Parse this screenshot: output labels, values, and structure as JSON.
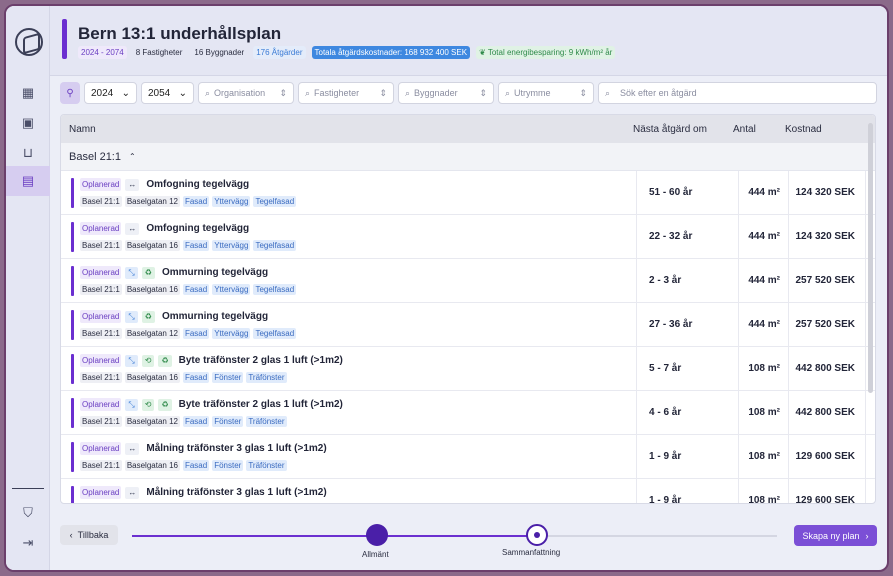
{
  "header": {
    "title": "Bern 13:1 underhållsplan",
    "badges": {
      "period": "2024 - 2074",
      "properties": "8 Fastigheter",
      "buildings": "16 Byggnader",
      "actions": "176 Åtgärder",
      "total_cost": "Totala åtgärdskostnader: 168 932 400 SEK",
      "energy": "Total energibesparing: 9 kWh/m² år"
    }
  },
  "filters": {
    "year_from": "2024",
    "year_to": "2054",
    "organisation": "Organisation",
    "properties": "Fastigheter",
    "buildings": "Byggnader",
    "spaces": "Utrymme",
    "search_placeholder": "Sök efter en åtgärd"
  },
  "table": {
    "headers": {
      "name": "Namn",
      "next": "Nästa åtgärd om",
      "count": "Antal",
      "cost": "Kostnad"
    },
    "group": "Basel 21:1",
    "rows": [
      {
        "status": "Oplanerad",
        "title": "Omfogning tegelvägg",
        "tags": [
          "Basel 21:1",
          "Baselgatan 12",
          "Fasad",
          "Yttervägg",
          "Tegelfasad"
        ],
        "next": "51 - 60 år",
        "count": "444 m²",
        "cost": "124 320 SEK"
      },
      {
        "status": "Oplanerad",
        "title": "Omfogning tegelvägg",
        "tags": [
          "Basel 21:1",
          "Baselgatan 16",
          "Fasad",
          "Yttervägg",
          "Tegelfasad"
        ],
        "next": "22 - 32 år",
        "count": "444 m²",
        "cost": "124 320 SEK"
      },
      {
        "status": "Oplanerad",
        "title": "Ommurning tegelvägg",
        "tags": [
          "Basel 21:1",
          "Baselgatan 16",
          "Fasad",
          "Yttervägg",
          "Tegelfasad"
        ],
        "next": "2 - 3 år",
        "count": "444 m²",
        "cost": "257 520 SEK"
      },
      {
        "status": "Oplanerad",
        "title": "Ommurning tegelvägg",
        "tags": [
          "Basel 21:1",
          "Baselgatan 12",
          "Fasad",
          "Yttervägg",
          "Tegelfasad"
        ],
        "next": "27 - 36 år",
        "count": "444 m²",
        "cost": "257 520 SEK"
      },
      {
        "status": "Oplanerad",
        "title": "Byte träfönster 2 glas 1 luft (>1m2)",
        "tags": [
          "Basel 21:1",
          "Baselgatan 16",
          "Fasad",
          "Fönster",
          "Träfönster"
        ],
        "next": "5 - 7 år",
        "count": "108 m²",
        "cost": "442 800 SEK"
      },
      {
        "status": "Oplanerad",
        "title": "Byte träfönster 2 glas 1 luft (>1m2)",
        "tags": [
          "Basel 21:1",
          "Baselgatan 12",
          "Fasad",
          "Fönster",
          "Träfönster"
        ],
        "next": "4 - 6 år",
        "count": "108 m²",
        "cost": "442 800 SEK"
      },
      {
        "status": "Oplanerad",
        "title": "Målning träfönster 3 glas 1 luft (>1m2)",
        "tags": [
          "Basel 21:1",
          "Baselgatan 16",
          "Fasad",
          "Fönster",
          "Träfönster"
        ],
        "next": "1 - 9 år",
        "count": "108 m²",
        "cost": "129 600 SEK"
      },
      {
        "status": "Oplanerad",
        "title": "Målning träfönster 3 glas 1 luft (>1m2)",
        "tags": [],
        "next": "1 - 9 år",
        "count": "108 m²",
        "cost": "129 600 SEK"
      }
    ]
  },
  "footer": {
    "back": "Tillbaka",
    "step1": "Allmänt",
    "step2": "Sammanfattning",
    "create": "Skapa ny plan"
  }
}
